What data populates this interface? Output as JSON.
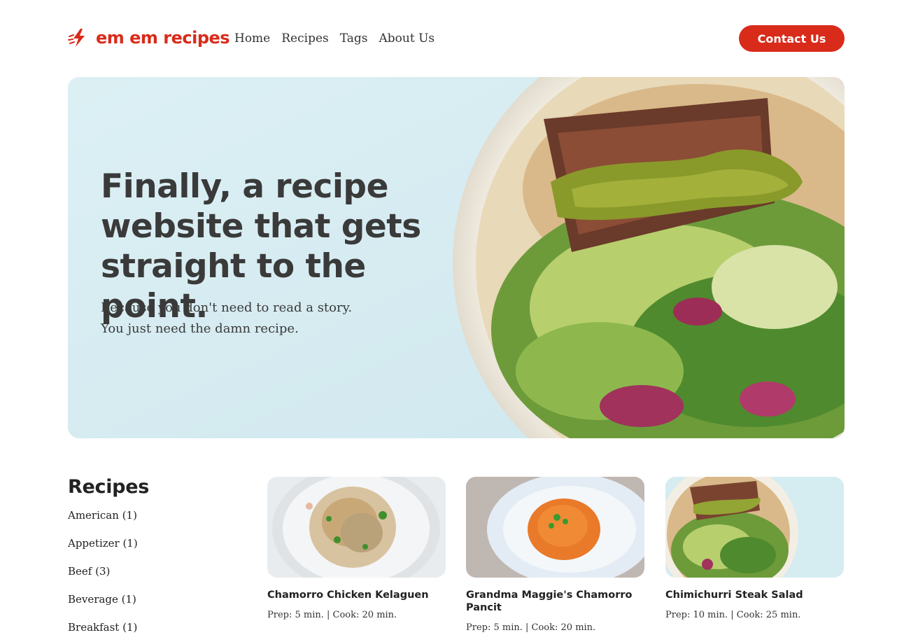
{
  "brand": {
    "name": "em em recipes",
    "color": "#d92b1a",
    "icon": "lightning-whisk-icon"
  },
  "nav": {
    "items": [
      "Home",
      "Recipes",
      "Tags",
      "About Us"
    ]
  },
  "header": {
    "contact_label": "Contact Us"
  },
  "hero": {
    "title": "Finally, a recipe website that gets straight to the point.",
    "subtitle_line1": "Because you don't need to read a story.",
    "subtitle_line2": "You just need the damn recipe.",
    "background_color": "#d5ecf1",
    "image": "steak-salad-bowl-photo"
  },
  "sidebar": {
    "heading": "Recipes",
    "categories": [
      {
        "label": "American (1)"
      },
      {
        "label": "Appetizer (1)"
      },
      {
        "label": "Beef (3)"
      },
      {
        "label": "Beverage (1)"
      },
      {
        "label": "Breakfast (1)"
      }
    ]
  },
  "recipes": [
    {
      "title": "Chamorro Chicken Kelaguen",
      "meta": "Prep: 5 min. | Cook: 20 min.",
      "image": "chicken-kelaguen-photo"
    },
    {
      "title": "Grandma Maggie's Chamorro Pancit",
      "meta": "Prep: 5 min. | Cook: 20 min.",
      "image": "pancit-noodles-photo"
    },
    {
      "title": "Chimichurri Steak Salad",
      "meta": "Prep: 10 min. | Cook: 25 min.",
      "image": "steak-salad-photo"
    }
  ]
}
